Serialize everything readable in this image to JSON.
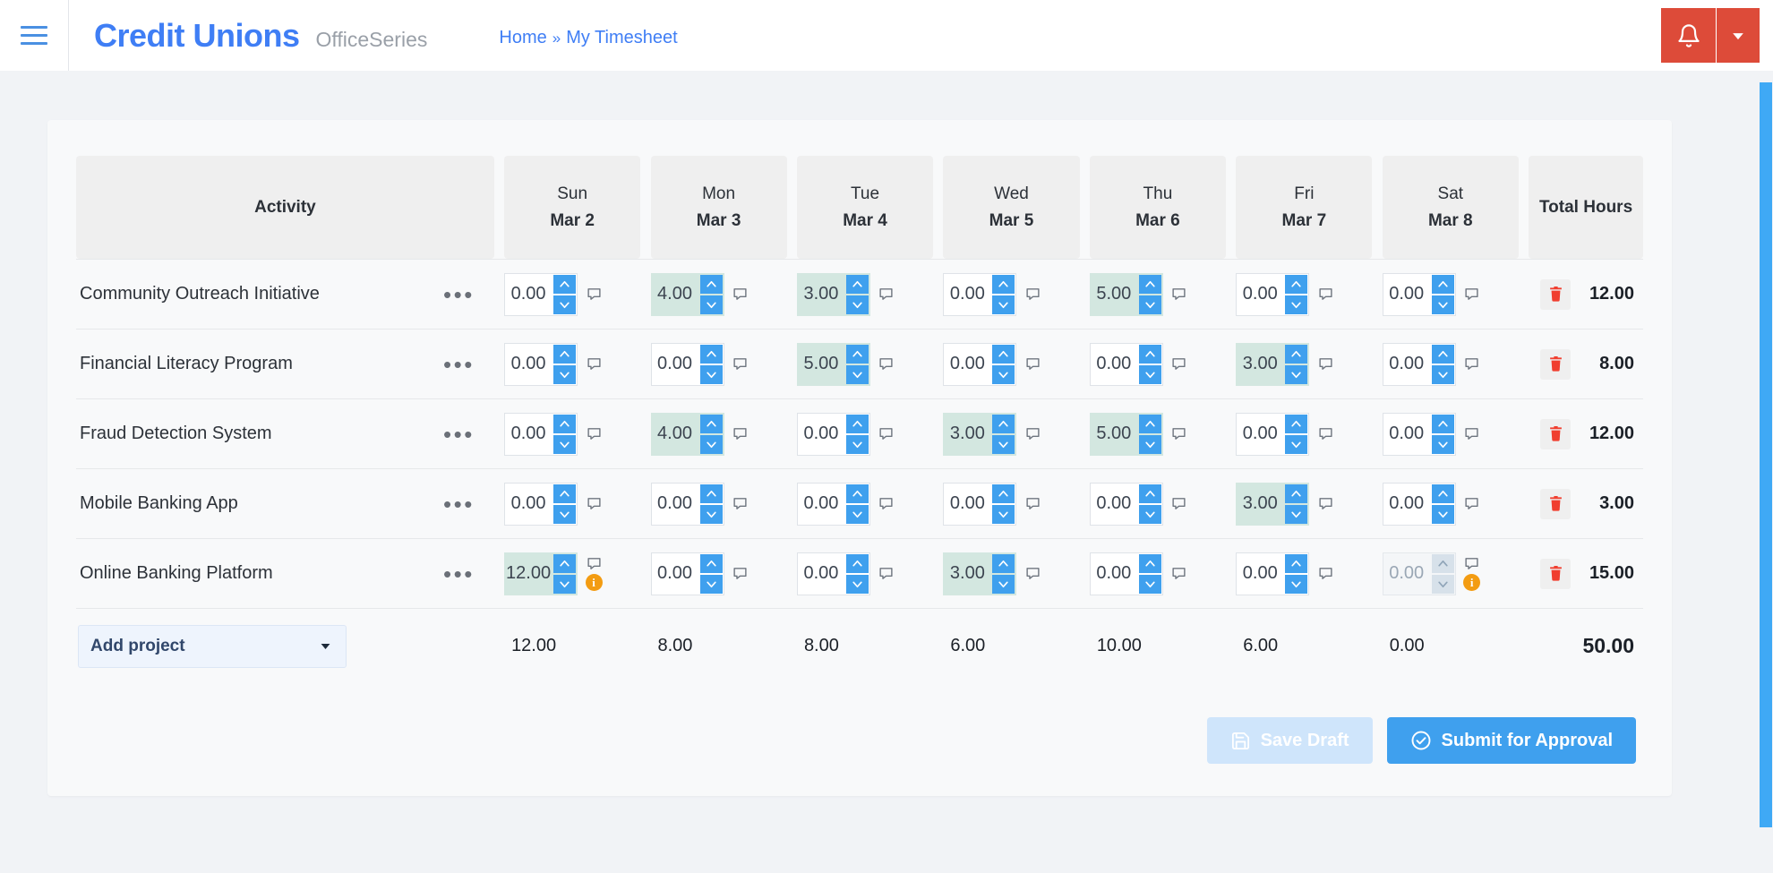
{
  "header": {
    "menu_icon": "hamburger-menu-icon",
    "brand_title": "Credit Unions",
    "brand_subtitle": "OfficeSeries",
    "breadcrumb": {
      "home": "Home",
      "separator": "»",
      "current": "My Timesheet"
    },
    "notification_icon": "bell-icon",
    "notification_caret_icon": "caret-down-icon",
    "accent_red": "#dd4b39",
    "accent_blue": "#3f7ef5"
  },
  "table": {
    "activity_header": "Activity",
    "total_header": "Total Hours",
    "days": [
      {
        "dow": "Sun",
        "date": "Mar 2"
      },
      {
        "dow": "Mon",
        "date": "Mar 3"
      },
      {
        "dow": "Tue",
        "date": "Mar 4"
      },
      {
        "dow": "Wed",
        "date": "Mar 5"
      },
      {
        "dow": "Thu",
        "date": "Mar 6"
      },
      {
        "dow": "Fri",
        "date": "Mar 7"
      },
      {
        "dow": "Sat",
        "date": "Mar 8"
      }
    ],
    "row_menu_label": "•••",
    "rows": [
      {
        "activity": "Community Outreach Initiative",
        "hours": [
          "0.00",
          "4.00",
          "3.00",
          "0.00",
          "5.00",
          "0.00",
          "0.00"
        ],
        "filled": [
          false,
          true,
          true,
          false,
          true,
          false,
          false
        ],
        "disabled": [
          false,
          false,
          false,
          false,
          false,
          false,
          false
        ],
        "info": [
          false,
          false,
          false,
          false,
          false,
          false,
          false
        ],
        "total": "12.00"
      },
      {
        "activity": "Financial Literacy Program",
        "hours": [
          "0.00",
          "0.00",
          "5.00",
          "0.00",
          "0.00",
          "3.00",
          "0.00"
        ],
        "filled": [
          false,
          false,
          true,
          false,
          false,
          true,
          false
        ],
        "disabled": [
          false,
          false,
          false,
          false,
          false,
          false,
          false
        ],
        "info": [
          false,
          false,
          false,
          false,
          false,
          false,
          false
        ],
        "total": "8.00"
      },
      {
        "activity": "Fraud Detection System",
        "hours": [
          "0.00",
          "4.00",
          "0.00",
          "3.00",
          "5.00",
          "0.00",
          "0.00"
        ],
        "filled": [
          false,
          true,
          false,
          true,
          true,
          false,
          false
        ],
        "disabled": [
          false,
          false,
          false,
          false,
          false,
          false,
          false
        ],
        "info": [
          false,
          false,
          false,
          false,
          false,
          false,
          false
        ],
        "total": "12.00"
      },
      {
        "activity": "Mobile Banking App",
        "hours": [
          "0.00",
          "0.00",
          "0.00",
          "0.00",
          "0.00",
          "3.00",
          "0.00"
        ],
        "filled": [
          false,
          false,
          false,
          false,
          false,
          true,
          false
        ],
        "disabled": [
          false,
          false,
          false,
          false,
          false,
          false,
          false
        ],
        "info": [
          false,
          false,
          false,
          false,
          false,
          false,
          false
        ],
        "total": "3.00"
      },
      {
        "activity": "Online Banking Platform",
        "hours": [
          "12.00",
          "0.00",
          "0.00",
          "3.00",
          "0.00",
          "0.00",
          "0.00"
        ],
        "filled": [
          true,
          false,
          false,
          true,
          false,
          false,
          false
        ],
        "disabled": [
          false,
          false,
          false,
          false,
          false,
          false,
          true
        ],
        "info": [
          true,
          false,
          false,
          false,
          false,
          false,
          true
        ],
        "total": "15.00"
      }
    ],
    "column_totals": [
      "12.00",
      "8.00",
      "8.00",
      "6.00",
      "10.00",
      "6.00",
      "0.00"
    ],
    "grand_total": "50.00",
    "delete_icon": "trash-icon",
    "comment_icon": "comment-icon",
    "info_icon": "info-badge-icon",
    "info_badge_char": "i",
    "filled_cell_color": "#d3e7e0",
    "spinner_button_color": "#3fa0ee",
    "info_badge_color": "#f39c12",
    "delete_icon_color": "#f03e2f"
  },
  "footer": {
    "add_project_label": "Add project",
    "add_project_caret_icon": "caret-down-icon"
  },
  "actions": {
    "save_draft_label": "Save Draft",
    "save_draft_icon": "save-disk-icon",
    "submit_label": "Submit for Approval",
    "submit_icon": "check-circle-icon"
  }
}
